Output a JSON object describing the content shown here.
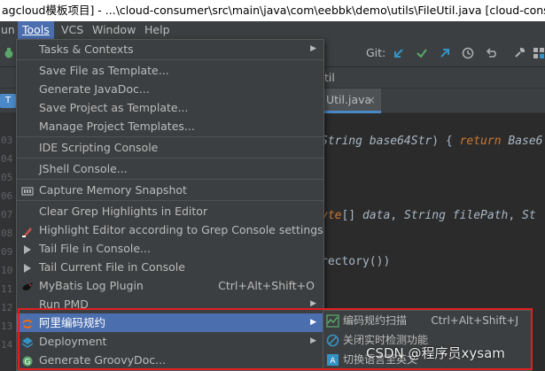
{
  "window": {
    "title": "agcloud模板项目] - ...\\cloud-consumer\\src\\main\\java\\com\\eebbk\\demo\\utils\\FileUtil.java [cloud-consumer]"
  },
  "menubar": {
    "items": [
      {
        "label": "un"
      },
      {
        "label": "Tools"
      },
      {
        "label": "VCS"
      },
      {
        "label": "Window"
      },
      {
        "label": "Help"
      }
    ]
  },
  "toolbar": {
    "git_label": "Git:",
    "icons": [
      "update-project-icon",
      "commit-icon",
      "push-icon",
      "history-icon",
      "rollback-icon",
      "settings-wrench-icon",
      "project-structure-icon"
    ]
  },
  "navbar": {
    "crumb": "til"
  },
  "editor_tab": {
    "label": "Util.java",
    "close": "×"
  },
  "left_tab": {
    "label": "T"
  },
  "gutter": {
    "lines": [
      "03",
      "04",
      "05",
      "06",
      "07",
      "08",
      "09",
      "10",
      "11",
      "12",
      "13",
      "14",
      "15",
      "16",
      "17",
      "18"
    ]
  },
  "code": {
    "line1": [
      "String",
      " ",
      "base64Str",
      ")",
      " { ",
      "return",
      " ",
      "Base6"
    ],
    "line2": [
      "yte",
      "[] ",
      "data",
      ", ",
      "String",
      " ",
      "filePath",
      ", ",
      "St"
    ],
    "line3": [
      "rectory())"
    ]
  },
  "tools_menu": {
    "items": [
      {
        "label": "Tasks & Contexts",
        "submenu": true
      },
      {
        "label": "Save File as Template..."
      },
      {
        "label": "Generate JavaDoc..."
      },
      {
        "label": "Save Project as Template..."
      },
      {
        "label": "Manage Project Templates..."
      },
      {
        "label": "IDE Scripting Console"
      },
      {
        "label": "JShell Console..."
      },
      {
        "label": "Capture Memory Snapshot"
      },
      {
        "label": "Clear Grep Highlights in Editor"
      },
      {
        "label": "Highlight Editor according to Grep Console settings"
      },
      {
        "label": "Tail File in Console..."
      },
      {
        "label": "Tail Current File in Console"
      },
      {
        "label": "MyBatis Log Plugin",
        "shortcut": "Ctrl+Alt+Shift+O"
      },
      {
        "label": "Run PMD",
        "submenu": true
      },
      {
        "label": "阿里编码规约",
        "submenu": true
      },
      {
        "label": "Deployment",
        "submenu": true
      },
      {
        "label": "Generate GroovyDoc..."
      }
    ]
  },
  "alibaba_submenu": {
    "items": [
      {
        "label": "编码规约扫描",
        "shortcut": "Ctrl+Alt+Shift+J"
      },
      {
        "label": "关闭实时检测功能"
      },
      {
        "label": "切换语言至英文"
      }
    ]
  },
  "watermark": {
    "text": "CSDN @程序员xysam"
  },
  "colors": {
    "menu_bg": "#3c3f41",
    "selection": "#4b6eaf",
    "annotation_red": "#e02020",
    "editor_bg": "#2b2b2b"
  }
}
